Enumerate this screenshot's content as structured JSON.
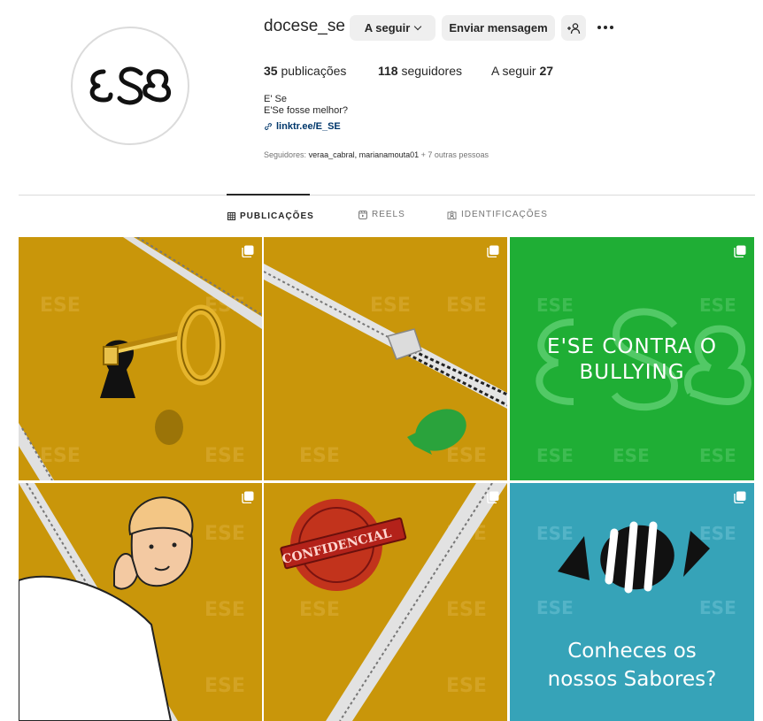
{
  "profile": {
    "username": "docese_se",
    "follow_button": "A seguir",
    "message_button": "Enviar mensagem",
    "add_user_icon": "person-plus-icon",
    "more_icon": "ellipsis-icon"
  },
  "stats": {
    "posts_count": "35",
    "posts_label": "publicações",
    "followers_count": "118",
    "followers_label": "seguidores",
    "following_label": "A seguir",
    "following_count": "27"
  },
  "bio": {
    "name": "E' Se",
    "text": "E'Se fosse melhor?",
    "link": "linktr.ee/E_SE",
    "followed_by_prefix": "Seguidores:",
    "followed_by_names": "veraa_cabral, marianamouta01",
    "followed_by_suffix": "+ 7 outras pessoas"
  },
  "tabs": [
    {
      "label": "PUBLICAÇÕES",
      "icon": "grid-icon",
      "active": true
    },
    {
      "label": "REELS",
      "icon": "reels-icon",
      "active": false
    },
    {
      "label": "IDENTIFICAÇÕES",
      "icon": "tag-person-icon",
      "active": false
    }
  ],
  "posts": [
    {
      "name": "post-key-keyhole",
      "bg": "#c9960a",
      "caption": ""
    },
    {
      "name": "post-zipper-candy",
      "bg": "#c9960a",
      "caption": ""
    },
    {
      "name": "post-bullying",
      "bg": "#1fae35",
      "caption_line1": "E'SE CONTRA O",
      "caption_line2": "BULLYING"
    },
    {
      "name": "post-thinking-boy",
      "bg": "#c9960a",
      "caption": ""
    },
    {
      "name": "post-confidencial",
      "bg": "#c9960a",
      "stamp_text": "CONFIDENCIAL"
    },
    {
      "name": "post-sabores",
      "bg": "#36a3b8",
      "caption_line1": "Conheces os",
      "caption_line2": "nossos Sabores?"
    }
  ],
  "watermark": "ESE",
  "colors": {
    "gold": "#c9960a",
    "green": "#1fae35",
    "teal": "#36a3b8",
    "link": "#00376b"
  }
}
